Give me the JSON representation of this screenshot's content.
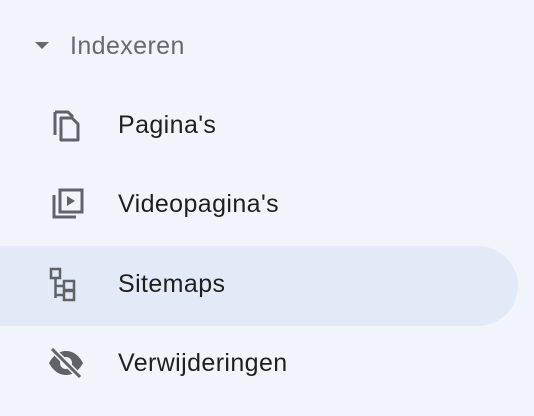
{
  "section": {
    "title": "Indexeren",
    "caret_icon": "caret-down-icon"
  },
  "items": [
    {
      "label": "Pagina's",
      "icon": "pages-icon",
      "active": false
    },
    {
      "label": "Videopagina's",
      "icon": "video-pages-icon",
      "active": false
    },
    {
      "label": "Sitemaps",
      "icon": "sitemap-icon",
      "active": true
    },
    {
      "label": "Verwijderingen",
      "icon": "eye-off-icon",
      "active": false
    }
  ],
  "colors": {
    "background": "#f1f5fb",
    "active_background": "#e2eaf8",
    "icon": "#5f6368",
    "text": "#1f1f1f",
    "section_text": "#646a70"
  }
}
